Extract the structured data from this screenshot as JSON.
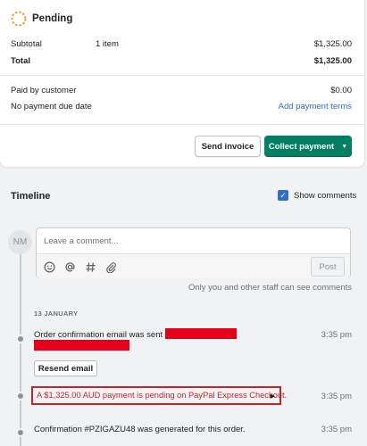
{
  "status": {
    "title": "Pending"
  },
  "summary": {
    "subtotal_label": "Subtotal",
    "subtotal_items": "1 item",
    "subtotal_value": "$1,325.00",
    "total_label": "Total",
    "total_value": "$1,325.00",
    "paid_label": "Paid by customer",
    "paid_value": "$0.00",
    "due_label": "No payment due date",
    "add_terms_link": "Add payment terms"
  },
  "actions": {
    "send_invoice": "Send invoice",
    "collect_payment": "Collect payment"
  },
  "timeline": {
    "title": "Timeline",
    "show_comments_label": "Show comments",
    "show_comments_checked": true,
    "avatar_initials": "NM",
    "comment_placeholder": "Leave a comment...",
    "post_label": "Post",
    "staff_note": "Only you and other staff can see comments",
    "date_label": "13 JANUARY",
    "events": [
      {
        "text": "Order confirmation email was sent to",
        "time": "3:35 pm",
        "button": "Resend email"
      },
      {
        "text": "A $1,325.00 AUD payment is pending on PayPal Express Checkout.",
        "time": "3:35 pm"
      },
      {
        "text": "Confirmation #PZIGAZU48 was generated for this order.",
        "time": "3:35 pm"
      }
    ]
  },
  "colors": {
    "primary_green": "#008060",
    "link_blue": "#2c6ecb",
    "highlight_red": "#c0272d",
    "redaction_red": "#e4001a",
    "pending_orange": "#e8a33d"
  },
  "icons": [
    "pending-status-icon",
    "emoji-icon",
    "mention-icon",
    "hashtag-icon",
    "attachment-icon",
    "caret-down-icon",
    "checkmark-icon",
    "play-arrow-icon"
  ]
}
